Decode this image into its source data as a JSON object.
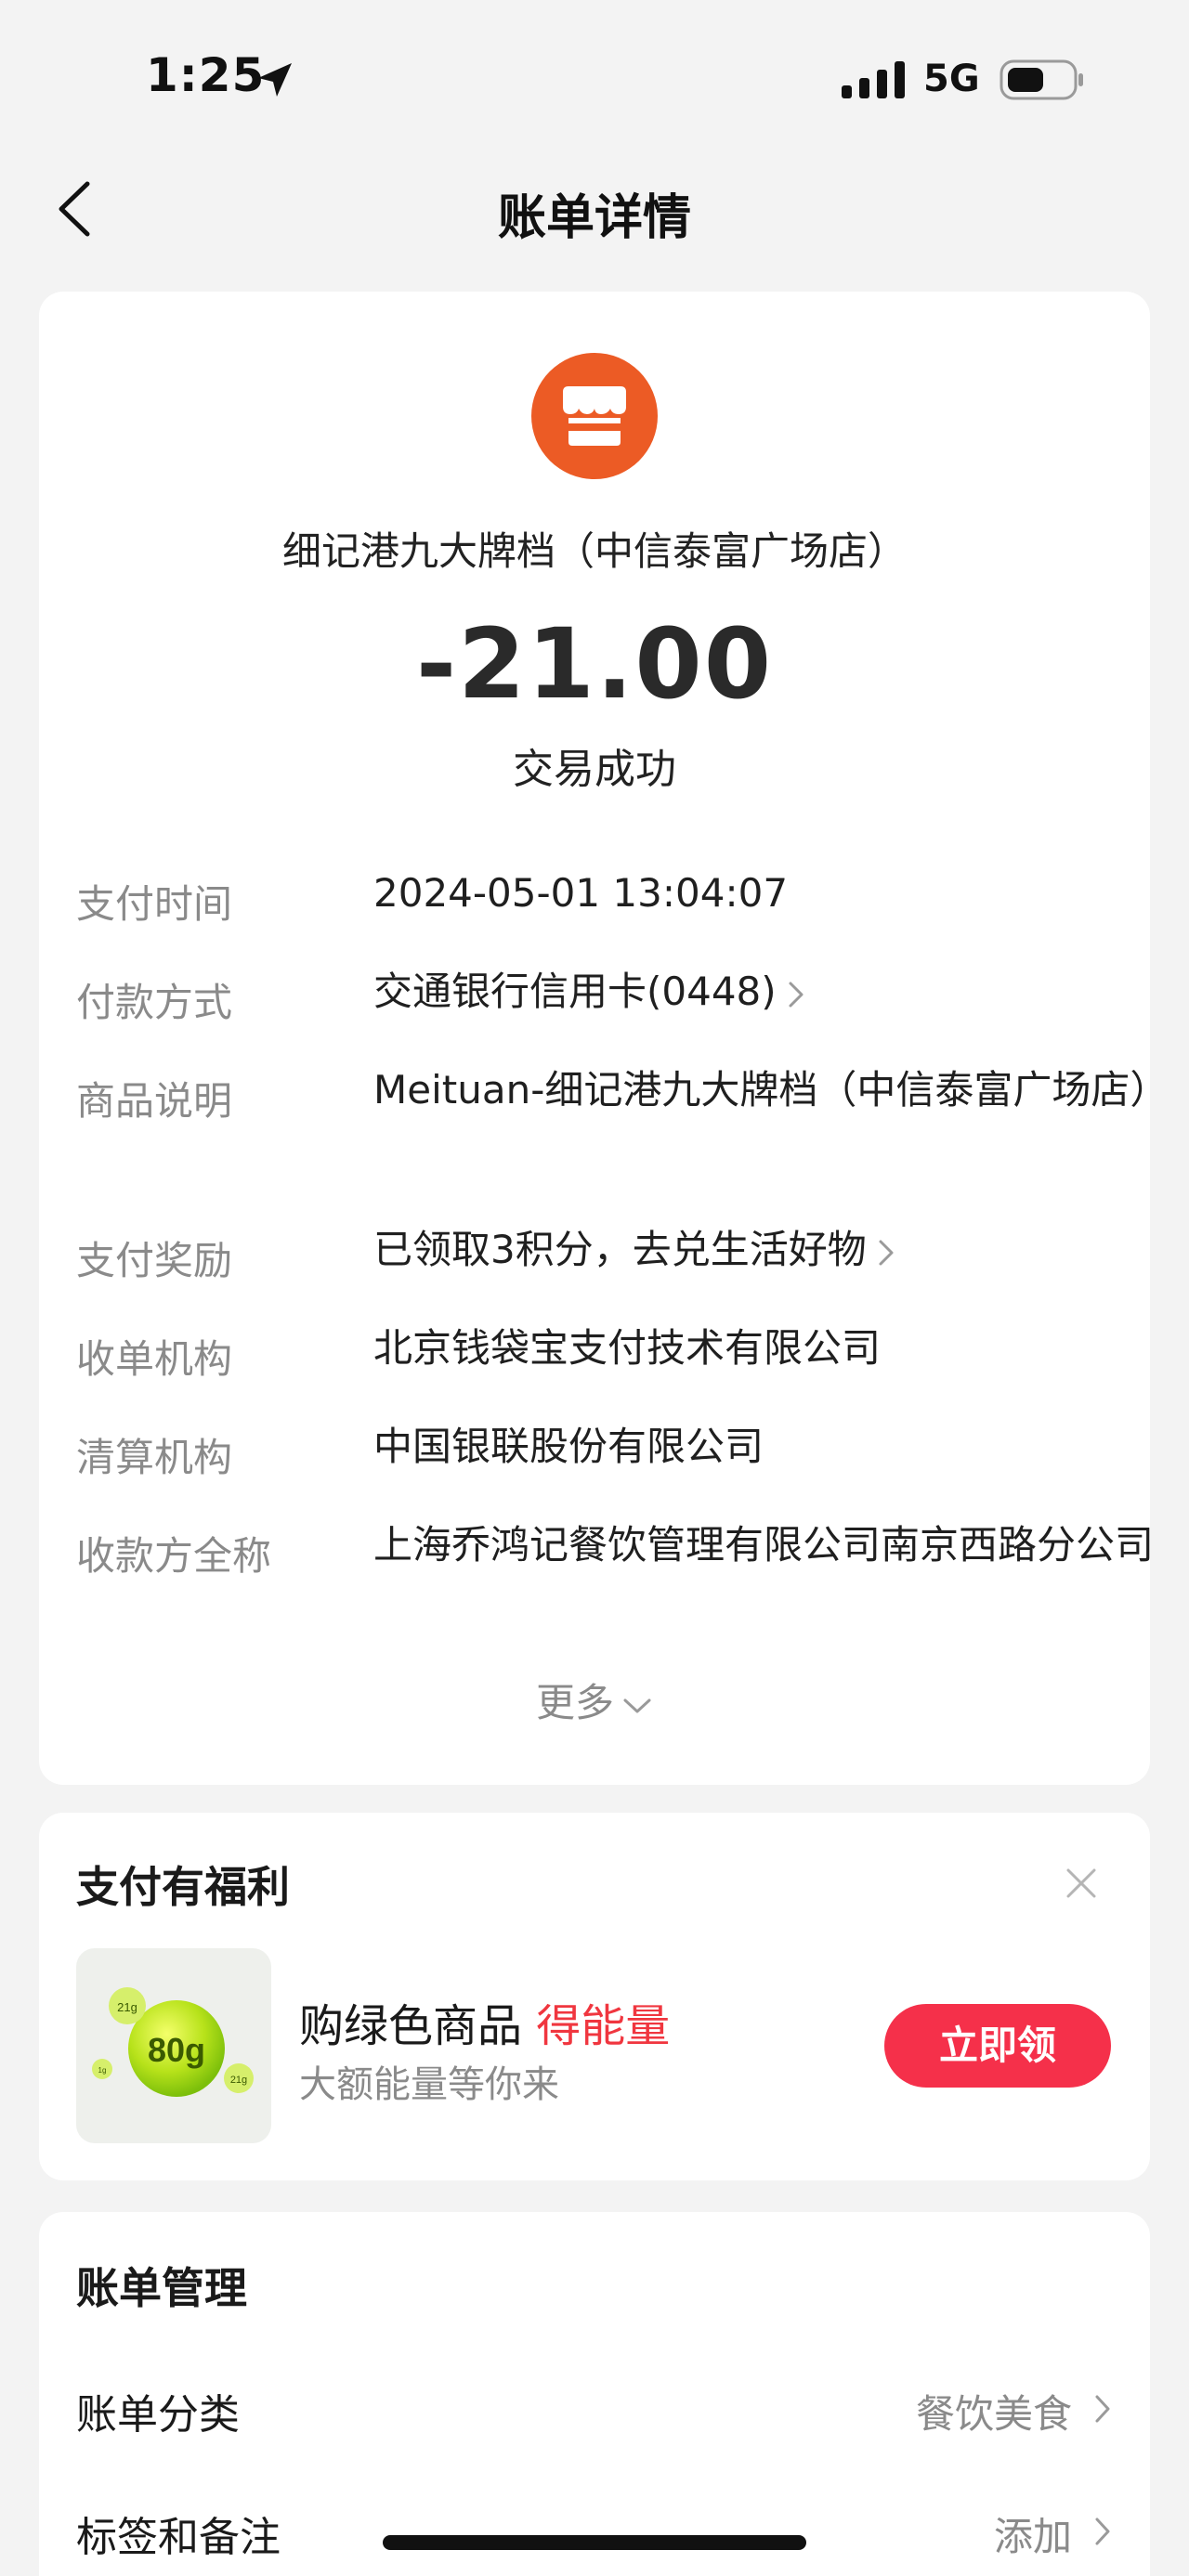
{
  "status_bar": {
    "time": "1:25",
    "network": "5G"
  },
  "nav": {
    "title": "账单详情"
  },
  "bill": {
    "merchant_name": "细记港九大牌档（中信泰富广场店）",
    "amount": "-21.00",
    "status": "交易成功",
    "details": [
      {
        "label": "支付时间",
        "value": "2024-05-01 13:04:07"
      },
      {
        "label": "付款方式",
        "value": "交通银行信用卡(0448)"
      },
      {
        "label": "商品说明",
        "value": "Meituan-细记港九大牌档（中信泰富广场店）"
      },
      {
        "label": "支付奖励",
        "value": "已领取3积分，去兑生活好物"
      },
      {
        "label": "收单机构",
        "value": "北京钱袋宝支付技术有限公司"
      },
      {
        "label": "清算机构",
        "value": "中国银联股份有限公司"
      },
      {
        "label": "收款方全称",
        "value": "上海乔鸿记餐饮管理有限公司南京西路分公司"
      }
    ],
    "more_label": "更多"
  },
  "benefit": {
    "title": "支付有福利",
    "promo_title_prefix": "购绿色商品 ",
    "promo_title_highlight": "得能量",
    "promo_subtitle": "大额能量等你来",
    "claim_label": "立即领",
    "thumb_main": "80g",
    "thumb_bubble_1": "21g",
    "thumb_bubble_2": "21g",
    "thumb_bubble_3": "1g"
  },
  "manage": {
    "title": "账单管理",
    "rows": [
      {
        "label": "账单分类",
        "value": "餐饮美食"
      },
      {
        "label": "标签和备注",
        "value": "添加"
      }
    ]
  },
  "colors": {
    "merchant_orange": "#ec5b25",
    "claim_red": "#f5304a",
    "highlight_red": "#f0363f"
  }
}
